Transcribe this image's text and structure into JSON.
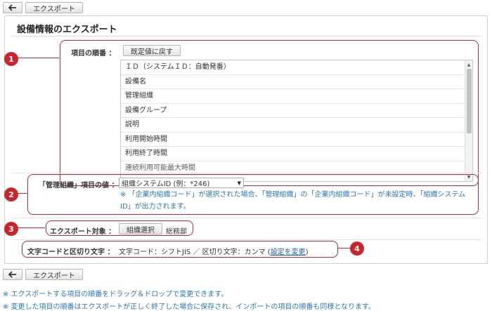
{
  "toolbar": {
    "export_label": "エクスポート"
  },
  "page_title": "設備情報のエクスポート",
  "item_order": {
    "label": "項目の順番 ：",
    "reset_label": "既定値に戻す",
    "items": [
      "ＩＤ（システムＩＤ：自動発番）",
      "設備名",
      "管理組織",
      "設備グループ",
      "説明",
      "利用開始時間",
      "利用終了時間",
      "連続利用可能最大時間"
    ]
  },
  "org_value": {
    "label": "「管理組織」項目の値 ：",
    "selected": "組織システムID (例：*246)",
    "note": "※ 「企業内組織コード」が選択された場合、「管理組織」の「企業内組織コード」が未設定時、「組織システムID」が出力されます。"
  },
  "export_target": {
    "label": "エクスポート対象 ：",
    "select_label": "組織選択",
    "value": "総務部"
  },
  "encoding": {
    "label": "文字コードと区切り文字 ：",
    "value": "文字コード：シフトJIS ／ 区切り文字：カンマ (",
    "link": "設定を変更",
    "suffix": ")"
  },
  "badges": [
    "1",
    "2",
    "3",
    "4"
  ],
  "footnotes": [
    "※ エクスポートする項目の順番をドラッグ＆ドロップで変更できます。",
    "※ 変更した項目の順番はエクスポートが正しく終了した場合に保存され、インポートの項目の順番も同様となります。"
  ],
  "colors": {
    "annotation": "#c9252f",
    "note": "#2a78b9",
    "link": "#1f5fb2"
  }
}
